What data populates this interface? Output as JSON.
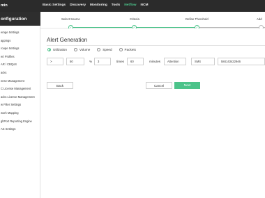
{
  "app": {
    "title": "min"
  },
  "nav": [
    "Basic Settings",
    "Discovery",
    "Monitoring",
    "Tools",
    "Netflow",
    "NCM"
  ],
  "nav_active": "Netflow",
  "sidebar": {
    "title": "onfiguration",
    "items": [
      "erage Settings",
      "appings",
      "roupe Settings",
      "ert Profiles",
      "AR / CBQoS",
      "acks",
      "ense Management",
      "C License Management",
      "acks License Management",
      "w Filter Settings",
      "work Mapping",
      "ghPort Reporting Engine",
      "AS Settings"
    ]
  },
  "stepper": {
    "steps": [
      "Select Source",
      "Criteria",
      "Define Threshold",
      "Add"
    ]
  },
  "form": {
    "title": "Alert Generation",
    "radios": [
      {
        "label": "Utilization",
        "selected": true
      },
      {
        "label": "Volume",
        "selected": false
      },
      {
        "label": "Speed",
        "selected": false
      },
      {
        "label": "Packets",
        "selected": false
      }
    ],
    "operator": ">",
    "percent_value": "50",
    "percent_sign": "%",
    "times_value": "3",
    "times_label": "times",
    "minutes_value": "60",
    "minutes_label": "minutes",
    "severity": "Attention",
    "action": "SMS",
    "phone": "584143422946"
  },
  "buttons": {
    "back": "Back",
    "cancel": "Cancel",
    "next": "Next"
  },
  "colors": {
    "accent": "#4cc38a",
    "topbar": "#2b2b2b"
  }
}
